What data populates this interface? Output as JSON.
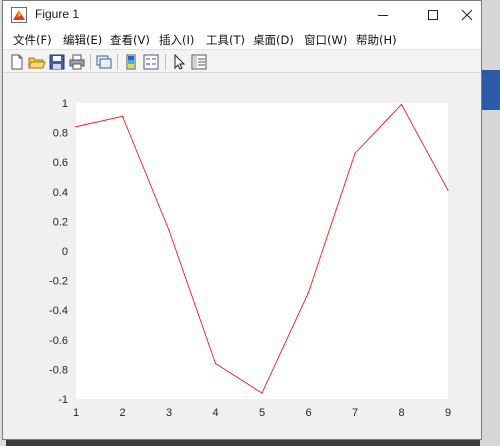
{
  "window": {
    "title": "Figure 1"
  },
  "menu": [
    {
      "label": "文件(F)"
    },
    {
      "label": "编辑(E)"
    },
    {
      "label": "查看(V)"
    },
    {
      "label": "插入(I)"
    },
    {
      "label": "工具(T)"
    },
    {
      "label": "桌面(D)"
    },
    {
      "label": "窗口(W)"
    },
    {
      "label": "帮助(H)"
    }
  ],
  "toolbar": [
    "new-figure-icon",
    "open-file-icon",
    "save-icon",
    "print-icon",
    "link-plot-icon",
    "colorbar-icon",
    "legend-icon",
    "pointer-icon",
    "property-editor-icon"
  ],
  "colors": {
    "line": "#ff0000",
    "axes_bg": "#ffffff",
    "figure_bg": "#f0f0f0"
  },
  "chart_data": {
    "type": "line",
    "x": [
      1,
      2,
      3,
      4,
      5,
      6,
      7,
      8,
      9
    ],
    "series": [
      {
        "values": [
          0.84,
          0.91,
          0.14,
          -0.76,
          -0.96,
          -0.28,
          0.66,
          0.99,
          0.41
        ]
      }
    ],
    "xlim": [
      1,
      9
    ],
    "ylim": [
      -1,
      1
    ],
    "xticks": [
      "1",
      "2",
      "3",
      "4",
      "5",
      "6",
      "7",
      "8",
      "9"
    ],
    "yticks": [
      "1",
      "0.8",
      "0.6",
      "0.4",
      "0.2",
      "0",
      "-0.2",
      "-0.4",
      "-0.6",
      "-0.8",
      "-1"
    ],
    "grid": false,
    "title": "",
    "xlabel": "",
    "ylabel": ""
  }
}
